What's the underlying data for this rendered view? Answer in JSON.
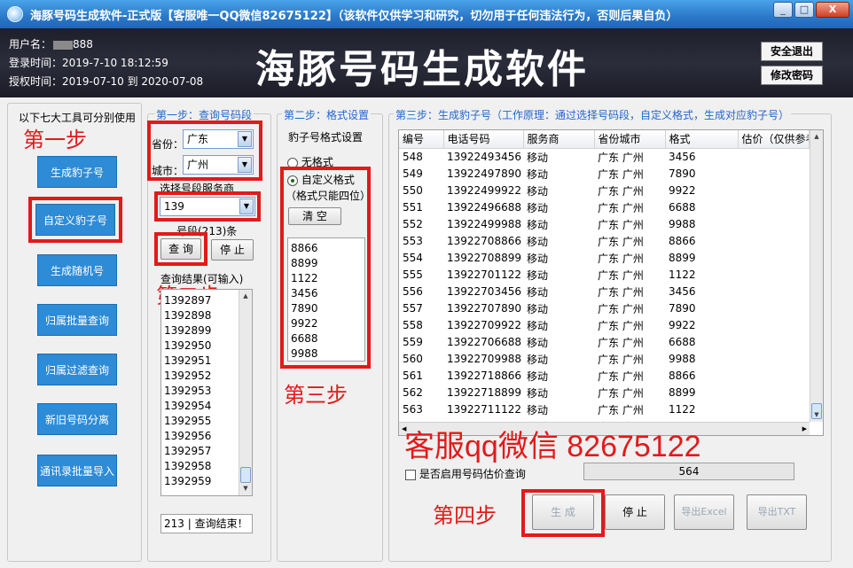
{
  "window": {
    "title": "海豚号码生成软件-正式版【客服唯一QQ微信82675122】（该软件仅供学习和研究，切勿用于任何违法行为，否则后果自负）",
    "min": "_",
    "max": "□",
    "close": "X"
  },
  "header": {
    "user_label": "用户名：",
    "user_value": "888",
    "login_label": "登录时间：",
    "login_value": "2019-7-10 18:12:59",
    "auth_label": "授权时间：",
    "auth_value": "2019-07-10 到 2020-07-08",
    "big_title": "海豚号码生成软件",
    "logout": "安全退出",
    "change_pwd": "修改密码"
  },
  "tools": {
    "heading": "以下七大工具可分别使用",
    "items": [
      "生成豹子号",
      "自定义豹子号",
      "生成随机号",
      "归属批量查询",
      "归属过滤查询",
      "新旧号码分离",
      "通讯录批量导入"
    ]
  },
  "annotations": {
    "step1": "第一步",
    "step2": "第二步",
    "step3": "第三步",
    "step4": "第四步",
    "service": "客服qq微信 82675122"
  },
  "step1": {
    "legend": "第一步：查询号码段",
    "province_label": "省份：",
    "province_value": "广东",
    "city_label": "城市：",
    "city_value": "广州",
    "carrier_label": "选择号段服务商",
    "carrier_value": "139",
    "count_text": "号段(213)条",
    "query_btn": "查 询",
    "stop_btn": "停 止",
    "result_label": "查询结果(可输入)",
    "results": [
      "1392897",
      "1392898",
      "1392899",
      "1392950",
      "1392951",
      "1392952",
      "1392953",
      "1392954",
      "1392955",
      "1392956",
      "1392957",
      "1392958",
      "1392959"
    ],
    "status": "213 | 查询结束！"
  },
  "step2": {
    "legend": "第二步：格式设置",
    "format_label": "豹子号格式设置",
    "opt_none": "无格式",
    "opt_custom": "自定义格式",
    "hint": "（格式只能四位）",
    "clear_btn": "清 空",
    "formats": [
      "8866",
      "8899",
      "1122",
      "3456",
      "7890",
      "9922",
      "6688",
      "9988"
    ]
  },
  "step3": {
    "legend": "第三步：生成豹子号（工作原理：通过选择号码段，自定义格式，生成对应豹子号）",
    "columns": [
      "编号",
      "电话号码",
      "服务商",
      "省份城市",
      "格式",
      "估价（仅供参考）"
    ],
    "rows": [
      [
        "548",
        "13922493456",
        "移动",
        "广东 广州",
        "3456",
        ""
      ],
      [
        "549",
        "13922497890",
        "移动",
        "广东 广州",
        "7890",
        ""
      ],
      [
        "550",
        "13922499922",
        "移动",
        "广东 广州",
        "9922",
        ""
      ],
      [
        "551",
        "13922496688",
        "移动",
        "广东 广州",
        "6688",
        ""
      ],
      [
        "552",
        "13922499988",
        "移动",
        "广东 广州",
        "9988",
        ""
      ],
      [
        "553",
        "13922708866",
        "移动",
        "广东 广州",
        "8866",
        ""
      ],
      [
        "554",
        "13922708899",
        "移动",
        "广东 广州",
        "8899",
        ""
      ],
      [
        "555",
        "13922701122",
        "移动",
        "广东 广州",
        "1122",
        ""
      ],
      [
        "556",
        "13922703456",
        "移动",
        "广东 广州",
        "3456",
        ""
      ],
      [
        "557",
        "13922707890",
        "移动",
        "广东 广州",
        "7890",
        ""
      ],
      [
        "558",
        "13922709922",
        "移动",
        "广东 广州",
        "9922",
        ""
      ],
      [
        "559",
        "13922706688",
        "移动",
        "广东 广州",
        "6688",
        ""
      ],
      [
        "560",
        "13922709988",
        "移动",
        "广东 广州",
        "9988",
        ""
      ],
      [
        "561",
        "13922718866",
        "移动",
        "广东 广州",
        "8866",
        ""
      ],
      [
        "562",
        "13922718899",
        "移动",
        "广东 广州",
        "8899",
        ""
      ],
      [
        "563",
        "13922711122",
        "移动",
        "广东 广州",
        "1122",
        ""
      ],
      [
        "564",
        "13922713456",
        "移动",
        "广东 广州",
        "3456",
        ""
      ]
    ],
    "estimate_checkbox": "是否启用号码估价查询",
    "total": "564",
    "generate_btn": "生 成",
    "stop_btn": "停 止",
    "export_excel": "导出Excel",
    "export_txt": "导出TXT"
  }
}
